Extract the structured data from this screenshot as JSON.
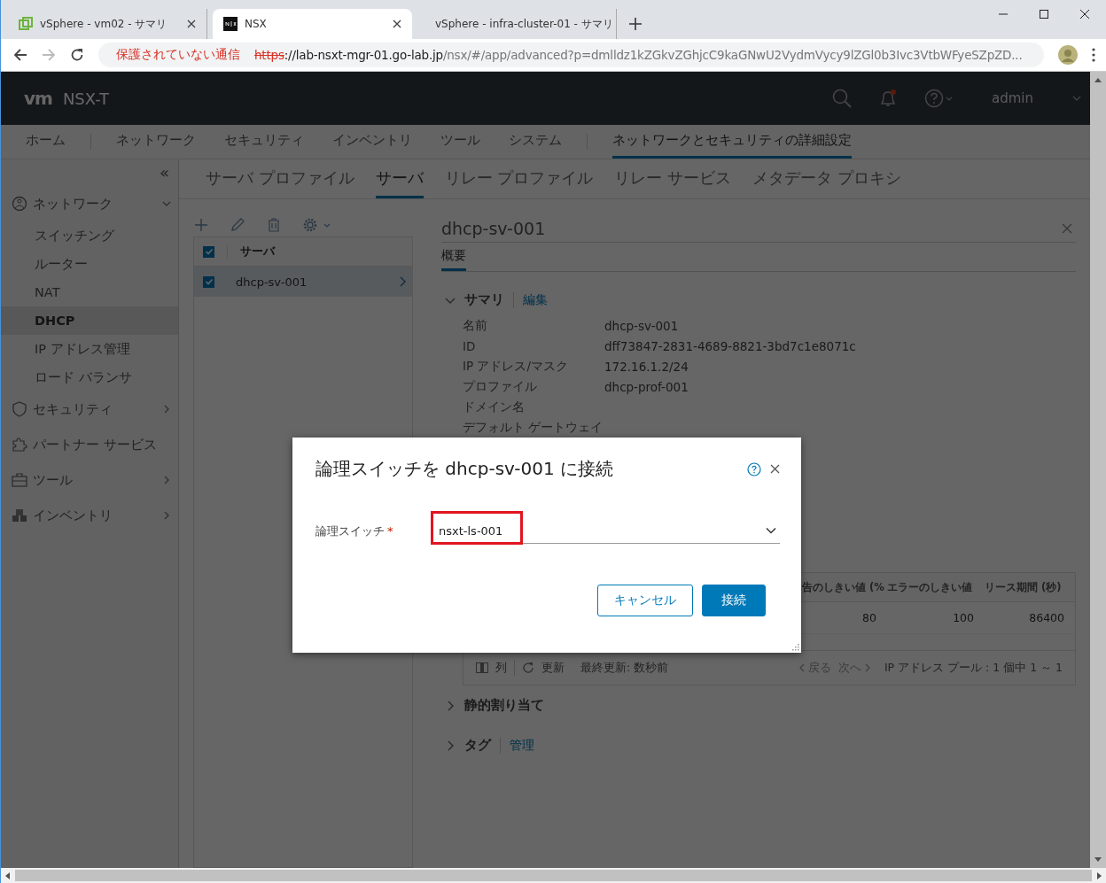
{
  "browser": {
    "tabs": [
      {
        "title": "vSphere - vm02 - サマリ",
        "selected": false
      },
      {
        "title": "NSX",
        "selected": true
      },
      {
        "title": "vSphere - infra-cluster-01 - サマリ",
        "selected": false
      }
    ],
    "forward_disabled": true,
    "security_warning": "保護されていない通信",
    "url": [
      {
        "kind": "scheme",
        "text": "https"
      },
      {
        "kind": "host",
        "text": "://lab-nsxt-mgr-01.go-lab.jp"
      },
      {
        "kind": "path",
        "text": "/nsx/#/app/advanced?p=dmlldz1kZGkvZGhjcC9kaGNwU2VydmVycy9lZGl0b3Ivc3VtbWFyeSZpZD..."
      }
    ]
  },
  "app": {
    "logo": "vm",
    "product": "NSX-T",
    "user": "admin",
    "has_notification": true
  },
  "main_nav": [
    [
      {
        "label": "ホーム",
        "selected": false
      }
    ],
    [
      {
        "label": "ネットワーク",
        "selected": false
      },
      {
        "label": "セキュリティ",
        "selected": false
      },
      {
        "label": "インベントリ",
        "selected": false
      },
      {
        "label": "ツール",
        "selected": false
      },
      {
        "label": "システム",
        "selected": false
      }
    ],
    [
      {
        "label": "ネットワークとセキュリティの詳細設定",
        "selected": true
      }
    ]
  ],
  "sidebar": {
    "collapse": "«",
    "items": [
      {
        "label": "ネットワーク",
        "expandable": true,
        "expanded": true,
        "children": [
          {
            "label": "スイッチング",
            "selected": false
          },
          {
            "label": "ルーター",
            "selected": false
          },
          {
            "label": "NAT",
            "selected": false
          },
          {
            "label": "DHCP",
            "selected": true
          },
          {
            "label": "IP アドレス管理",
            "selected": false
          },
          {
            "label": "ロード バランサ",
            "selected": false
          }
        ]
      },
      {
        "label": "セキュリティ",
        "expandable": true,
        "expanded": false
      },
      {
        "label": "パートナー サービス",
        "expandable": false
      },
      {
        "label": "ツール",
        "expandable": true,
        "expanded": false
      },
      {
        "label": "インベントリ",
        "expandable": true,
        "expanded": false
      }
    ]
  },
  "tabs": [
    {
      "label": "サーバ プロファイル",
      "selected": false
    },
    {
      "label": "サーバ",
      "selected": true
    },
    {
      "label": "リレー プロファイル",
      "selected": false
    },
    {
      "label": "リレー サービス",
      "selected": false
    },
    {
      "label": "メタデータ プロキシ",
      "selected": false
    }
  ],
  "server_list": {
    "column": "サーバ",
    "header_checked": true,
    "rows": [
      {
        "name": "dhcp-sv-001",
        "checked": true,
        "selected": true
      }
    ]
  },
  "detail": {
    "title": "dhcp-sv-001",
    "tabs": [
      {
        "label": "概要",
        "selected": true
      }
    ],
    "summary": {
      "title": "サマリ",
      "expanded": true,
      "action": "編集",
      "fields": [
        {
          "label": "名前",
          "value": "dhcp-sv-001"
        },
        {
          "label": "ID",
          "value": "dff73847-2831-4689-8821-3bd7c1e8071c"
        },
        {
          "label": "IP アドレス/マスク",
          "value": "172.16.1.2/24"
        },
        {
          "label": "プロファイル",
          "value": "dhcp-prof-001"
        },
        {
          "label": "ドメイン名"
        },
        {
          "label": "デフォルト ゲートウェイ"
        }
      ]
    },
    "pool_table": {
      "columns": [
        "告のしきい値 (%",
        "エラーのしきい値",
        "リース期間 (秒)"
      ],
      "rows": [
        [
          "80",
          "100",
          "86400"
        ]
      ],
      "footer": {
        "columns": "列",
        "refresh": "更新",
        "last_updated": "最終更新: 数秒前",
        "prev": "戻る",
        "next": "次へ",
        "pager_disabled": true,
        "count": "IP アドレス プール : 1 個中 1 ～ 1"
      }
    },
    "sections": [
      {
        "title": "静的割り当て",
        "expanded": false
      },
      {
        "title": "タグ",
        "expanded": false,
        "action": "管理"
      }
    ]
  },
  "dialog": {
    "title": "論理スイッチを dhcp-sv-001 に接続",
    "field": {
      "label": "論理スイッチ",
      "required_mark": "*",
      "value": "nsxt-ls-001",
      "highlighted": true
    },
    "buttons": [
      {
        "label": "キャンセル",
        "kind": "secondary"
      },
      {
        "label": "接続",
        "kind": "primary"
      }
    ]
  }
}
